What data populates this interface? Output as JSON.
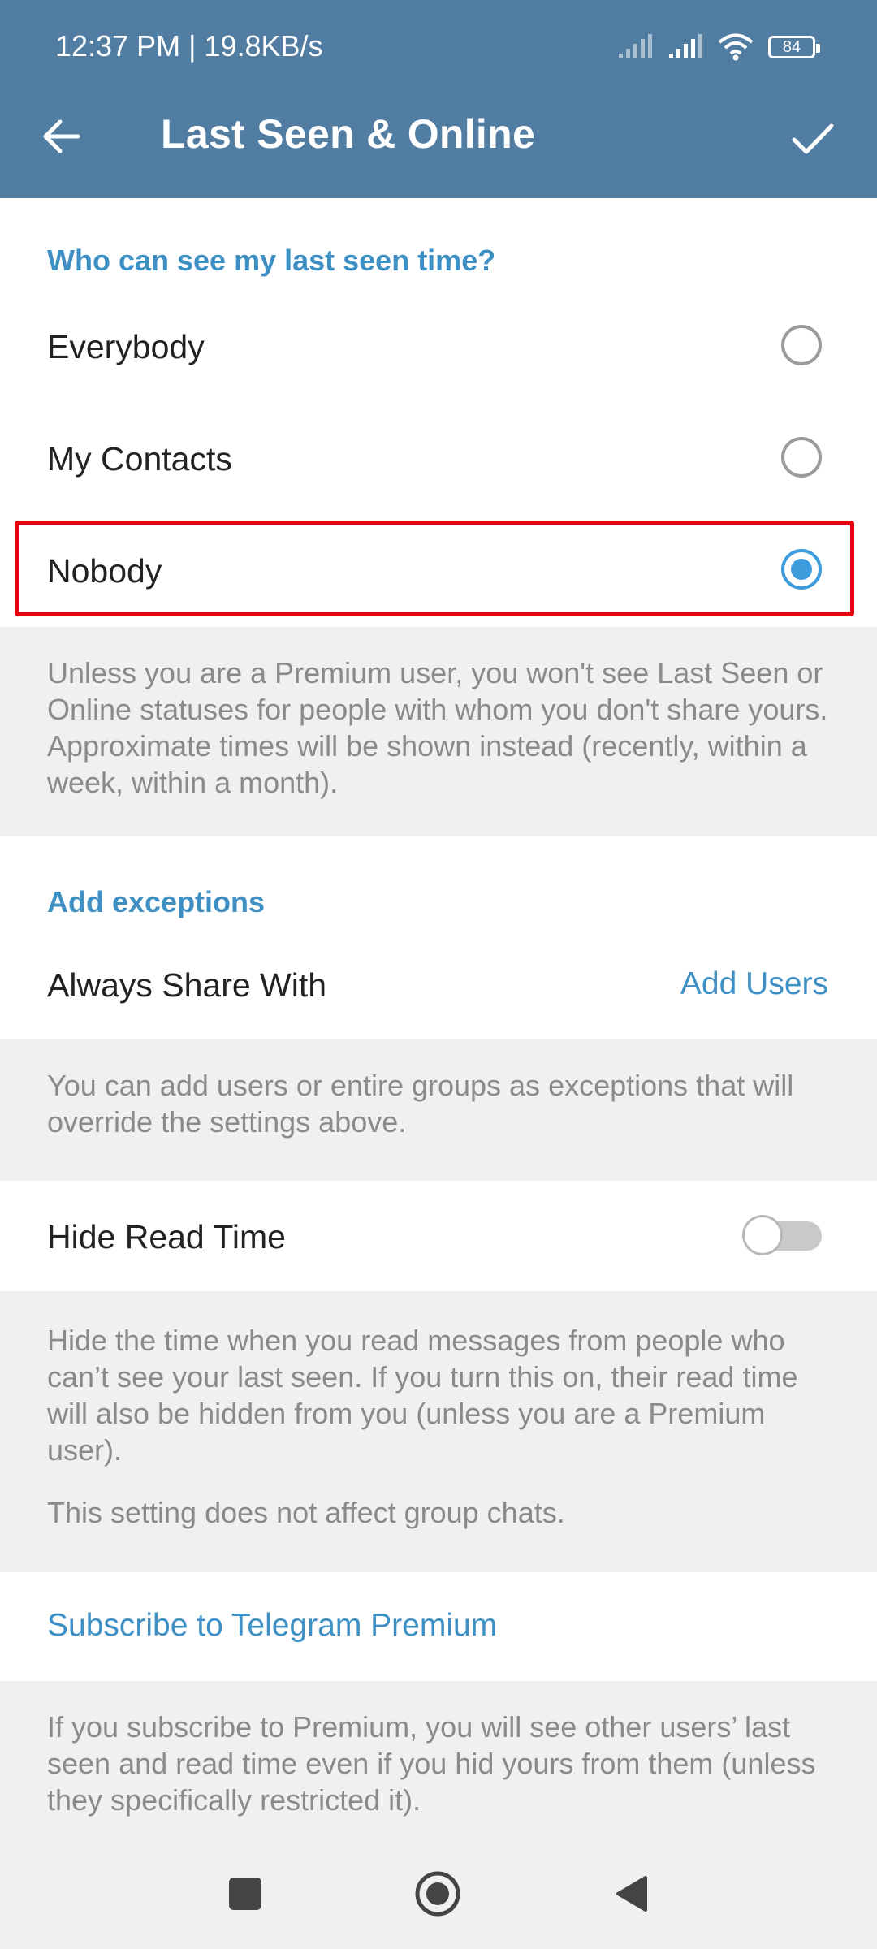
{
  "status_bar": {
    "time": "12:37 PM | 19.8KB/s",
    "battery": "84",
    "icons": [
      "signal-icon",
      "signal-icon",
      "wifi-icon",
      "battery-icon"
    ]
  },
  "header": {
    "title": "Last Seen & Online",
    "back_icon": "back-arrow-icon",
    "done_icon": "checkmark-icon",
    "color": "#517da2"
  },
  "last_seen": {
    "section_label": "Who can see my last seen time?",
    "options": [
      {
        "label": "Everybody",
        "selected": false
      },
      {
        "label": "My Contacts",
        "selected": false
      },
      {
        "label": "Nobody",
        "selected": true
      }
    ],
    "info": "Unless you are a Premium user, you won't see Last Seen or Online statuses for people with whom you don't share yours. Approximate times will be shown instead (recently, within a week, within a month)."
  },
  "exceptions": {
    "section_label": "Add exceptions",
    "always_share_label": "Always Share With",
    "add_users_label": "Add Users",
    "info": "You can add users or entire groups as exceptions that will override the settings above."
  },
  "hide_read_time": {
    "label": "Hide Read Time",
    "enabled": false,
    "info": "Hide the time when you read messages from people who can’t see your last seen. If you turn this on, their read time will also be hidden from you (unless you are a Premium user).",
    "info2": "This setting does not affect group chats."
  },
  "premium": {
    "link_label": "Subscribe to Telegram Premium",
    "info": "If you subscribe to Premium, you will see other users’ last seen and read time even if you hid yours from them (unless they specifically restricted it)."
  },
  "navbar": {
    "icons": [
      "square-icon",
      "home-circle-icon",
      "back-triangle-icon"
    ]
  },
  "colors": {
    "accent": "#3d8fc4",
    "radio_selected": "#3d9cdb",
    "highlight": "#e60012"
  }
}
